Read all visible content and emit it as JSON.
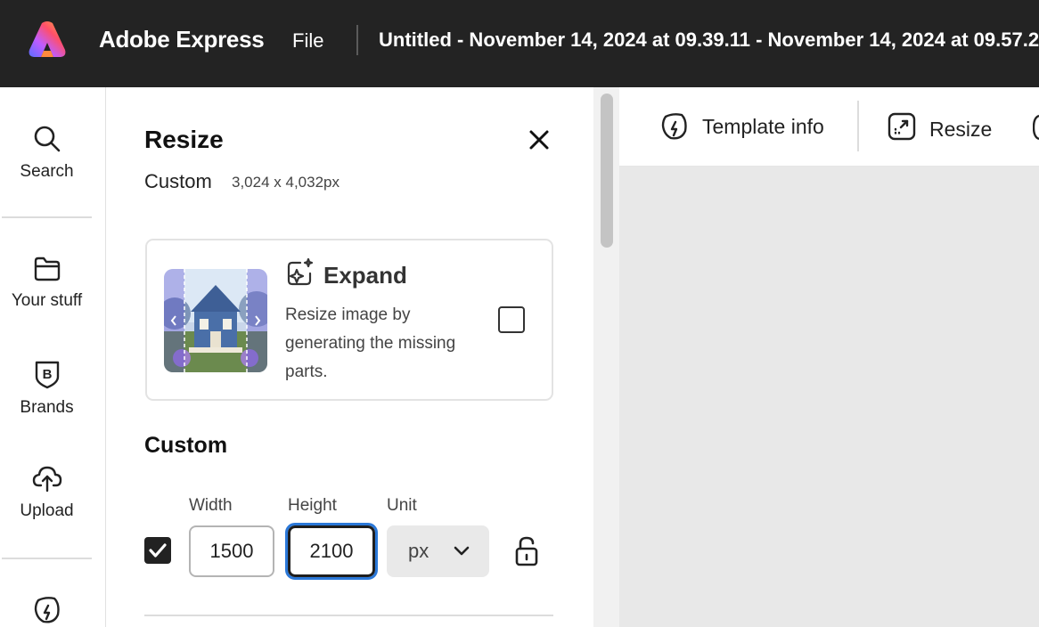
{
  "topbar": {
    "app_name": "Adobe Express",
    "file_menu": "File",
    "document_title": "Untitled - November 14, 2024 at 09.39.11 - November 14, 2024 at 09.57.2"
  },
  "rail": {
    "items": [
      {
        "label": "Search",
        "icon": "search-icon"
      },
      {
        "label": "Your stuff",
        "icon": "folder-icon"
      },
      {
        "label": "Brands",
        "icon": "brand-icon"
      },
      {
        "label": "Upload",
        "icon": "upload-cloud-icon"
      },
      {
        "label": "",
        "icon": "template-icon"
      }
    ]
  },
  "panel": {
    "title": "Resize",
    "size_name": "Custom",
    "size_dims": "3,024 x 4,032px",
    "expand": {
      "title": "Expand",
      "description": "Resize image by generating the missing parts.",
      "checked": false
    },
    "custom_heading": "Custom",
    "width_label": "Width",
    "height_label": "Height",
    "unit_label": "Unit",
    "width_value": "1500",
    "height_value": "2100",
    "unit_value": "px",
    "keep_checked": true
  },
  "toolbar": {
    "template_info": "Template info",
    "resize": "Resize"
  },
  "colors": {
    "topbar_bg": "#232323",
    "canvas_bg": "#e8e8e8",
    "focus_ring": "#2b78d8"
  }
}
